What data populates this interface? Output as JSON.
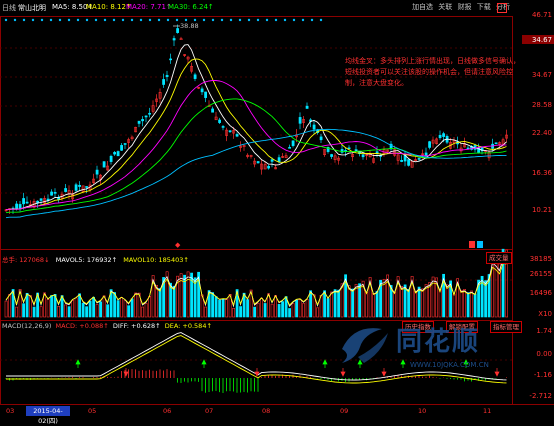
{
  "top": {
    "code": "日线",
    "name": "常山北明",
    "ma5": "MA5: 8.50↑",
    "ma10": "MA10: 8.12↑",
    "ma20": "MA20: 7.71↑",
    "ma30": "MA30: 6.24↑",
    "tabs": [
      "加自选",
      "关联",
      "财报",
      "下载",
      "分析"
    ]
  },
  "colors": {
    "up": "#ff3030",
    "down": "#00e5ff",
    "ma5": "#ffffff",
    "ma10": "#ffff00",
    "ma20": "#ff00ff",
    "ma30": "#00ff00",
    "ma60": "#00bfff"
  },
  "price_axis": [
    "46.71",
    "40.52",
    "34.67",
    "28.58",
    "22.40",
    "16.36",
    "10.21"
  ],
  "price_highlight": "34.67",
  "high_label": "38.88",
  "annotation": "均线金叉：多头排列上涨行情出现，日线做多信号确认，短线投资者可以关注该股的操作机会，但请注意风险控制，注意大盘变化。",
  "volume": {
    "label": "总手: 127068↓",
    "mavol5": "MAVOL5: 176932↑",
    "mavol10": "MAVOL10: 185403↑",
    "btn": "成交量",
    "axis": [
      "38185",
      "26155",
      "16496",
      "X10"
    ]
  },
  "macd": {
    "label": "MACD(12,26,9)",
    "macd": "MACD: +0.088↑",
    "diff": "DIFF: +0.628↑",
    "dea": "DEA: +0.584↑",
    "btns": [
      "历史指数",
      "解锁配置",
      "指标管理"
    ],
    "axis": [
      "1.74",
      "0.00",
      "-1.16",
      "-2.712"
    ]
  },
  "time_axis": [
    "03",
    "05",
    "06",
    "07",
    "08",
    "09",
    "10",
    "11"
  ],
  "current_date": "2015-04-02(四)",
  "watermark": {
    "brand": "同花顺",
    "url": "WWW.10JQKA.COM.CN"
  }
}
